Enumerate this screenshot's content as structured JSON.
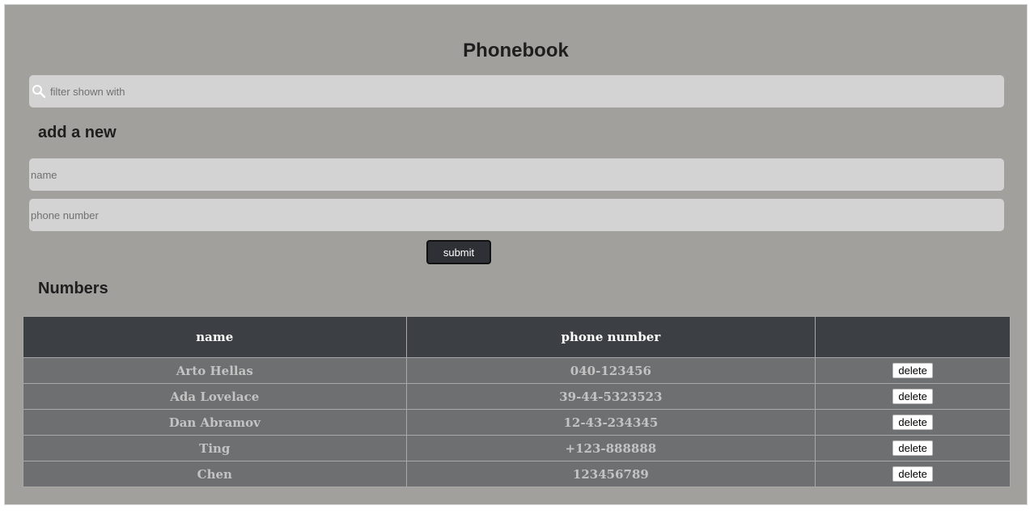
{
  "app": {
    "title": "Phonebook"
  },
  "filter": {
    "placeholder": "filter shown with",
    "value": ""
  },
  "add_form": {
    "heading": "add a new",
    "name_placeholder": "name",
    "number_placeholder": "phone number",
    "submit_label": "submit"
  },
  "numbers": {
    "heading": "Numbers",
    "columns": [
      "name",
      "phone number",
      ""
    ],
    "rows": [
      {
        "name": "Arto Hellas",
        "number": "040-123456",
        "action": "delete"
      },
      {
        "name": "Ada Lovelace",
        "number": "39-44-5323523",
        "action": "delete"
      },
      {
        "name": "Dan Abramov",
        "number": "12-43-234345",
        "action": "delete"
      },
      {
        "name": "Ting",
        "number": "+123-888888",
        "action": "delete"
      },
      {
        "name": "Chen",
        "number": "123456789",
        "action": "delete"
      }
    ]
  },
  "colors": {
    "background": "#a2a09d",
    "input_background": "#d3d3d3",
    "table_header": "#3c4045",
    "table_row": "#6e6f71",
    "submit_button": "#2e3035"
  },
  "icons": {
    "filter": "search-icon"
  }
}
